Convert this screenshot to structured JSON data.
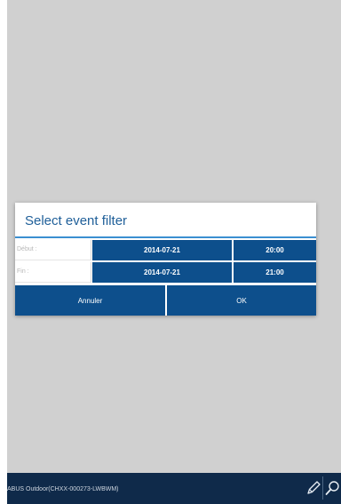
{
  "dialog": {
    "title": "Select event filter",
    "start_label": "Début :",
    "start_date": "2014-07-21",
    "start_time": "20:00",
    "end_label": "Fin :",
    "end_date": "2014-07-21",
    "end_time": "21:00",
    "cancel_label": "Annuler",
    "ok_label": "OK"
  },
  "bottom_bar": {
    "device_title": "ABUS Outdoor(CHXX-000273-LWBWM)",
    "icons": [
      "pencil-icon",
      "search-icon"
    ]
  },
  "colors": {
    "accent": "#0d4f8c",
    "title_text": "#1f5f99",
    "title_underline": "#3b8fd1",
    "background": "#d0d0d0",
    "bottom_bar": "#0f2a4a"
  }
}
